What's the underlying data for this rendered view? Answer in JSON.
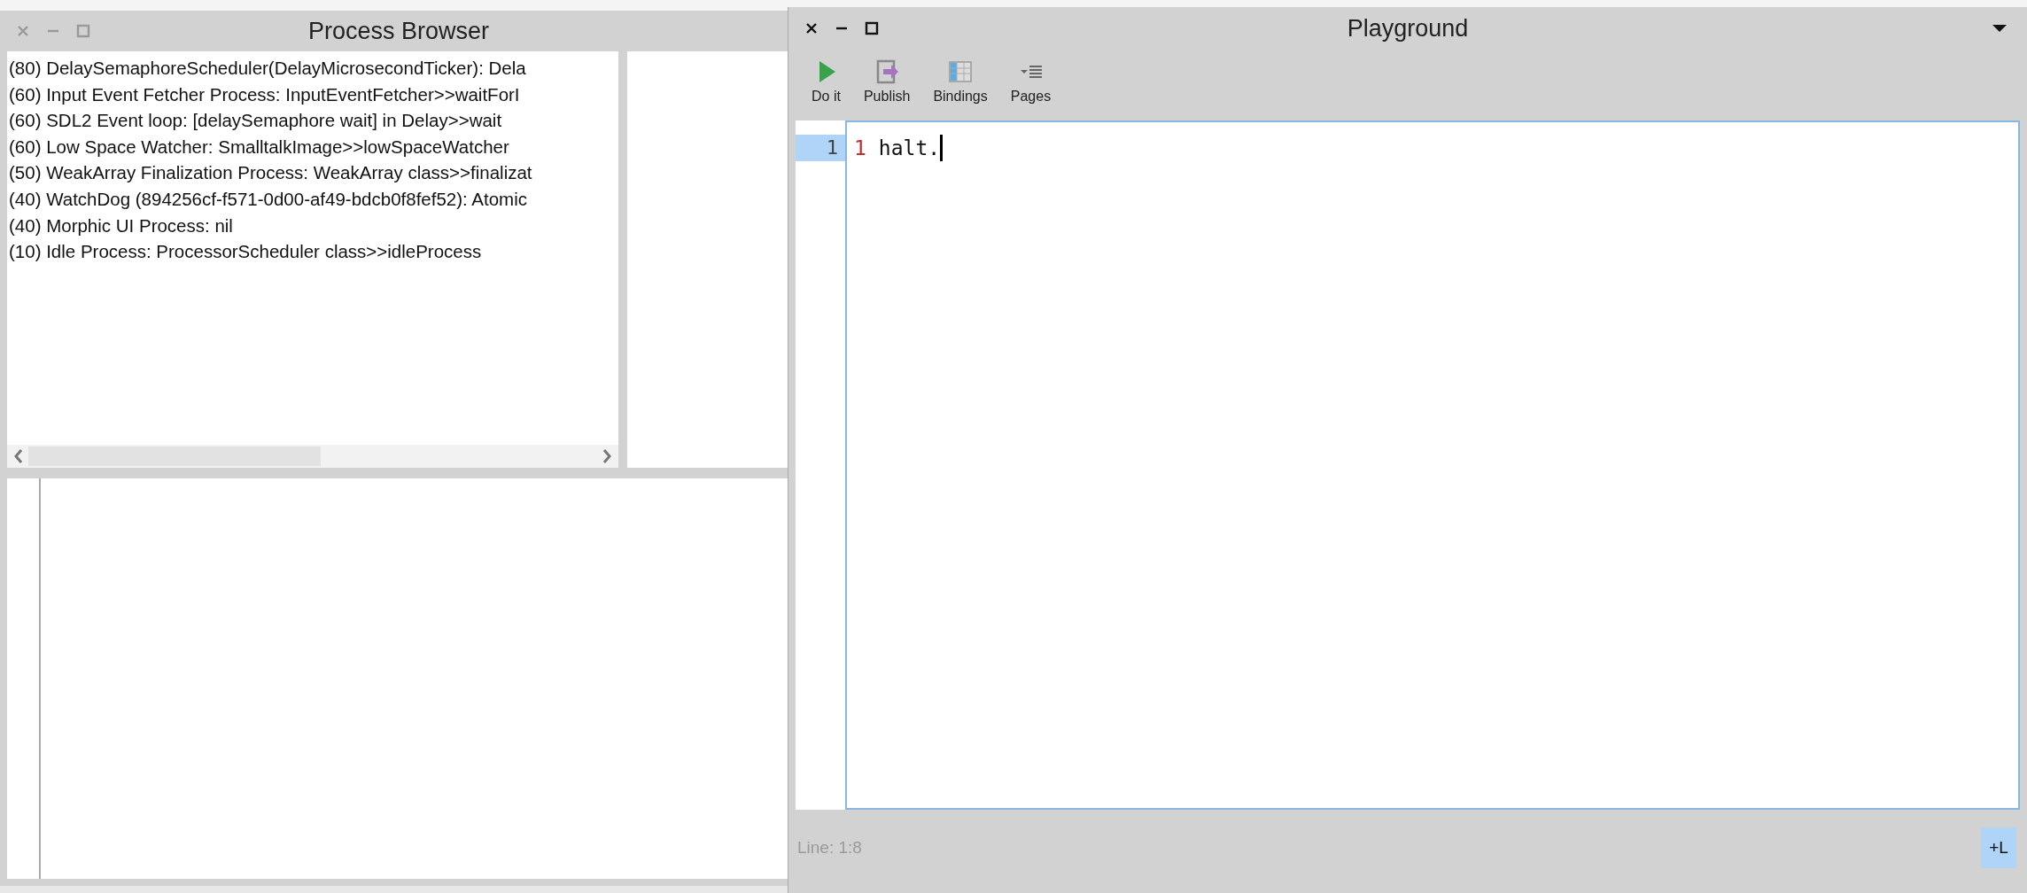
{
  "process_browser": {
    "title": "Process Browser",
    "active": false,
    "processes": [
      {
        "text": "(80) DelaySemaphoreScheduler(DelayMicrosecondTicker): Dela"
      },
      {
        "text": "(60) Input Event Fetcher Process: InputEventFetcher>>waitForI"
      },
      {
        "text": "(60) SDL2 Event loop: [delaySemaphore wait] in Delay>>wait"
      },
      {
        "text": "(60) Low Space Watcher: SmalltalkImage>>lowSpaceWatcher"
      },
      {
        "text": "(50) WeakArray Finalization Process: WeakArray class>>finalizat"
      },
      {
        "text": "(40) WatchDog (894256cf-f571-0d00-af49-bdcb0f8fef52): Atomic"
      },
      {
        "text": "(40) Morphic UI Process: nil"
      },
      {
        "text": "(10) Idle Process: ProcessorScheduler class>>idleProcess"
      }
    ]
  },
  "playground": {
    "title": "Playground",
    "active": true,
    "toolbar": [
      {
        "label": "Do it",
        "kind": "run"
      },
      {
        "label": "Publish",
        "kind": "publish"
      },
      {
        "label": "Bindings",
        "kind": "bindings"
      },
      {
        "label": "Pages",
        "kind": "pages"
      }
    ],
    "editor": {
      "lines": [
        {
          "number": "1",
          "selected": true,
          "tokens": [
            {
              "text": "1",
              "kind": "number"
            },
            {
              "text": "halt.",
              "kind": "identifier"
            }
          ]
        }
      ]
    },
    "status": "Line: 1:8",
    "line_toggle": {
      "label": "+L",
      "on": true
    }
  }
}
